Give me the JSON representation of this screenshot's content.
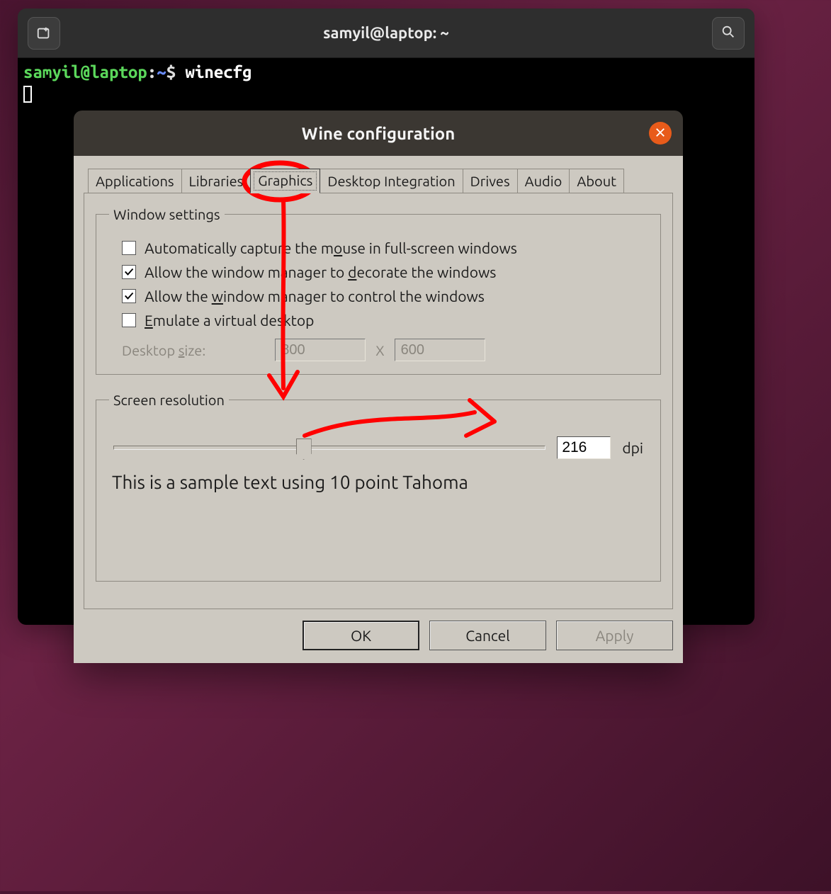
{
  "terminal": {
    "title": "samyil@laptop: ~",
    "prompt_user": "samyil@laptop",
    "prompt_colon": ":",
    "prompt_path": "~",
    "prompt_symbol": "$ ",
    "command": "winecfg"
  },
  "wine": {
    "title": "Wine configuration",
    "tabs": {
      "applications": "Applications",
      "libraries": "Libraries",
      "graphics": "Graphics",
      "desktop_integration": "Desktop Integration",
      "drives": "Drives",
      "audio": "Audio",
      "about": "About"
    },
    "window_settings": {
      "legend": "Window settings",
      "auto_capture_pre": "Automatically capture the m",
      "auto_capture_udl": "o",
      "auto_capture_post": "use in full-screen windows",
      "decorate_pre": "Allow the window manager to ",
      "decorate_udl": "d",
      "decorate_post": "ecorate the windows",
      "control_pre": "Allow the ",
      "control_udl": "w",
      "control_post": "indow manager to control the windows",
      "emulate_udl": "E",
      "emulate_post": "mulate a virtual desktop",
      "desktop_size_pre": "Desktop ",
      "desktop_size_udl": "s",
      "desktop_size_post": "ize:",
      "width": "800",
      "x": "X",
      "height": "600"
    },
    "screen_resolution": {
      "legend": "Screen resolution",
      "dpi_value": "216",
      "dpi_label": "dpi",
      "sample": "This is a sample text using 10 point Tahoma",
      "slider_percent": 44
    },
    "buttons": {
      "ok": "OK",
      "cancel": "Cancel",
      "apply": "Apply"
    }
  }
}
